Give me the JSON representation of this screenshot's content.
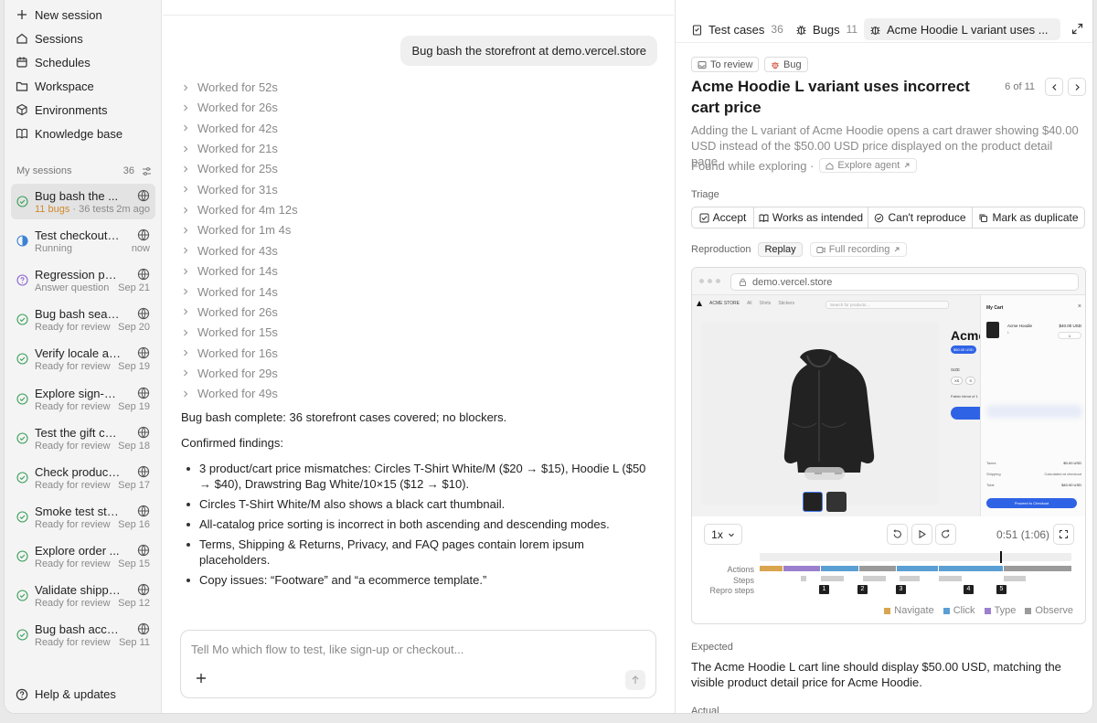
{
  "nav": {
    "new_session": "New session",
    "sessions": "Sessions",
    "schedules": "Schedules",
    "workspace": "Workspace",
    "environments": "Environments",
    "knowledge_base": "Knowledge base"
  },
  "my_sessions": {
    "label": "My sessions",
    "count": "36"
  },
  "sessions": [
    {
      "title": "Bug bash the ...",
      "bugs": "11 bugs",
      "sep": " · ",
      "detail": "36 tests",
      "date": "2m ago",
      "status": "done"
    },
    {
      "title": "Test checkout wit...",
      "detail": "Running",
      "date": "now",
      "status": "running"
    },
    {
      "title": "Regression pass ...",
      "detail": "Answer question",
      "date": "Sep 21",
      "status": "question"
    },
    {
      "title": "Bug bash search, ...",
      "detail": "Ready for review",
      "date": "Sep 20",
      "status": "done"
    },
    {
      "title": "Verify locale and ...",
      "detail": "Ready for review",
      "date": "Sep 19",
      "status": "done"
    },
    {
      "title": "Explore sign-up, ...",
      "detail": "Ready for review",
      "date": "Sep 19",
      "status": "done"
    },
    {
      "title": "Test the gift card ...",
      "detail": "Ready for review",
      "date": "Sep 18",
      "status": "done"
    },
    {
      "title": "Check product ...",
      "detail": "Ready for review",
      "date": "Sep 17",
      "status": "done"
    },
    {
      "title": "Smoke test stagin...",
      "detail": "Ready for review",
      "date": "Sep 16",
      "status": "done"
    },
    {
      "title": "Explore order ...",
      "detail": "Ready for review",
      "date": "Sep 15",
      "status": "done"
    },
    {
      "title": "Validate shipping ...",
      "detail": "Ready for review",
      "date": "Sep 12",
      "status": "done"
    },
    {
      "title": "Bug bash account...",
      "detail": "Ready for review",
      "date": "Sep 11",
      "status": "done"
    }
  ],
  "help": "Help & updates",
  "chat": {
    "user_message": "Bug bash the storefront at demo.vercel.store",
    "worked": [
      "Worked for 52s",
      "Worked for 26s",
      "Worked for 42s",
      "Worked for 21s",
      "Worked for 25s",
      "Worked for 31s",
      "Worked for 4m 12s",
      "Worked for 1m 4s",
      "Worked for 43s",
      "Worked for 14s",
      "Worked for 14s",
      "Worked for 26s",
      "Worked for 15s",
      "Worked for 16s",
      "Worked for 29s",
      "Worked for 49s"
    ],
    "summary": "Bug bash complete: 36 storefront cases covered; no blockers.",
    "findings_title": "Confirmed findings:",
    "findings": [
      "3 product/cart price mismatches: Circles T-Shirt White/M ($20 → $15), Hoodie L ($50 → $40), Drawstring Bag White/10×15 ($12 → $10).",
      "Circles T-Shirt White/M also shows a black cart thumbnail.",
      "All-catalog price sorting is incorrect in both ascending and descending modes.",
      "Terms, Shipping & Returns, Privacy, and FAQ pages contain lorem ipsum placeholders.",
      "Copy issues: “Footware” and “a ecommerce template.”"
    ],
    "composer_placeholder": "Tell Mo which flow to test, like sign-up or checkout..."
  },
  "panel": {
    "tabs": [
      {
        "label": "Test cases",
        "count": "36"
      },
      {
        "label": "Bugs",
        "count": "11"
      },
      {
        "label": "Acme Hoodie L variant uses ..."
      }
    ],
    "chips": {
      "status": "To review",
      "type": "Bug"
    },
    "pager": "6 of 11",
    "title": "Acme Hoodie L variant uses incorrect cart price",
    "description": "Adding the L variant of Acme Hoodie opens a cart drawer showing $40.00 USD instead of the $50.00 USD price displayed on the product detail page.",
    "found_prefix": "Found while exploring ·",
    "found_agent": "Explore agent",
    "triage_label": "Triage",
    "triage": [
      "Accept",
      "Works as intended",
      "Can't reproduce",
      "Mark as duplicate"
    ],
    "repro_label": "Reproduction",
    "replay": "Replay",
    "full_recording": "Full recording",
    "url": "demo.vercel.store",
    "speed": "1x",
    "time": "0:51 (1:06)",
    "tracks": {
      "actions": "Actions",
      "steps": "Steps",
      "repro": "Repro steps"
    },
    "repro_steps": [
      "1",
      "2",
      "3",
      "4",
      "5"
    ],
    "legend": [
      {
        "label": "Navigate",
        "color": "#d9a54e"
      },
      {
        "label": "Click",
        "color": "#5a9fd4"
      },
      {
        "label": "Type",
        "color": "#9b7fcf"
      },
      {
        "label": "Observe",
        "color": "#9a9a9a"
      }
    ],
    "expected_label": "Expected",
    "expected": "The Acme Hoodie L cart line should display $50.00 USD, matching the visible product detail price for Acme Hoodie.",
    "actual_label": "Actual"
  },
  "screenshot": {
    "brand": "ACME STORE",
    "nav": [
      "All",
      "Shirts",
      "Stickers"
    ],
    "search": "Search for products...",
    "product_title": "Acme",
    "price": "$50.00 USD",
    "size_label": "SIZE",
    "sizes": [
      "XS",
      "S"
    ],
    "fabric": "Fabric blend of 1",
    "cart_title": "My Cart",
    "cart_item": "Acme Hoodie",
    "cart_item_price": "$40.00 USD",
    "cart_variant": "L",
    "qty": "1",
    "taxes_label": "Taxes",
    "taxes_value": "$0.00 USD",
    "shipping_label": "Shipping",
    "shipping_value": "Calculated at checkout",
    "total_label": "Total",
    "total_value": "$40.00 USD",
    "checkout": "Proceed to Checkout"
  }
}
